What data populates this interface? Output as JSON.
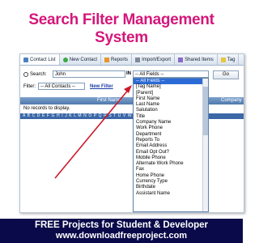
{
  "page": {
    "title": "Search Filter Management System"
  },
  "tabs": [
    {
      "label": "Contact List",
      "icon": "contact-list-icon"
    },
    {
      "label": "New Contact",
      "icon": "new-contact-icon"
    },
    {
      "label": "Reports",
      "icon": "reports-icon"
    },
    {
      "label": "Import/Export",
      "icon": "import-export-icon"
    },
    {
      "label": "Shared Items",
      "icon": "shared-items-icon"
    },
    {
      "label": "Tag",
      "icon": "tag-icon"
    }
  ],
  "search": {
    "label": "Search:",
    "value": "John",
    "in_label": "IN",
    "field_selected": "-- All Fields --",
    "go_label": "Go"
  },
  "filter": {
    "label": "Filter:",
    "selected": "-- All Contacts --",
    "new_filter_label": "New Filter"
  },
  "grid": {
    "columns": [
      "First Name",
      "Company"
    ],
    "empty_text": "No records to display.",
    "alphabet": "A B C D E F G H I J K L M N O P Q R S T U V W X Y Z"
  },
  "dropdown_options": [
    "-- All Fields --",
    "[Tag Name]",
    "[Parent]",
    "First Name",
    "Last Name",
    "Salutation",
    "Title",
    "Company Name",
    "Work Phone",
    "Department",
    "Reports To",
    "Email Address",
    "Email Opt Out?",
    "Mobile Phone",
    "Alternate Work Phone",
    "Fax",
    "Home Phone",
    "Currency Type",
    "Birthdate",
    "Assistant Name"
  ],
  "footer": {
    "line1": "FREE Projects for Student & Developer",
    "line2": "www.downloadfreeproject.com"
  },
  "colors": {
    "title": "#d4177a",
    "footer_bg": "#0a0a4a",
    "arrow": "#cc1a2a",
    "selection": "#2c6bd6"
  }
}
